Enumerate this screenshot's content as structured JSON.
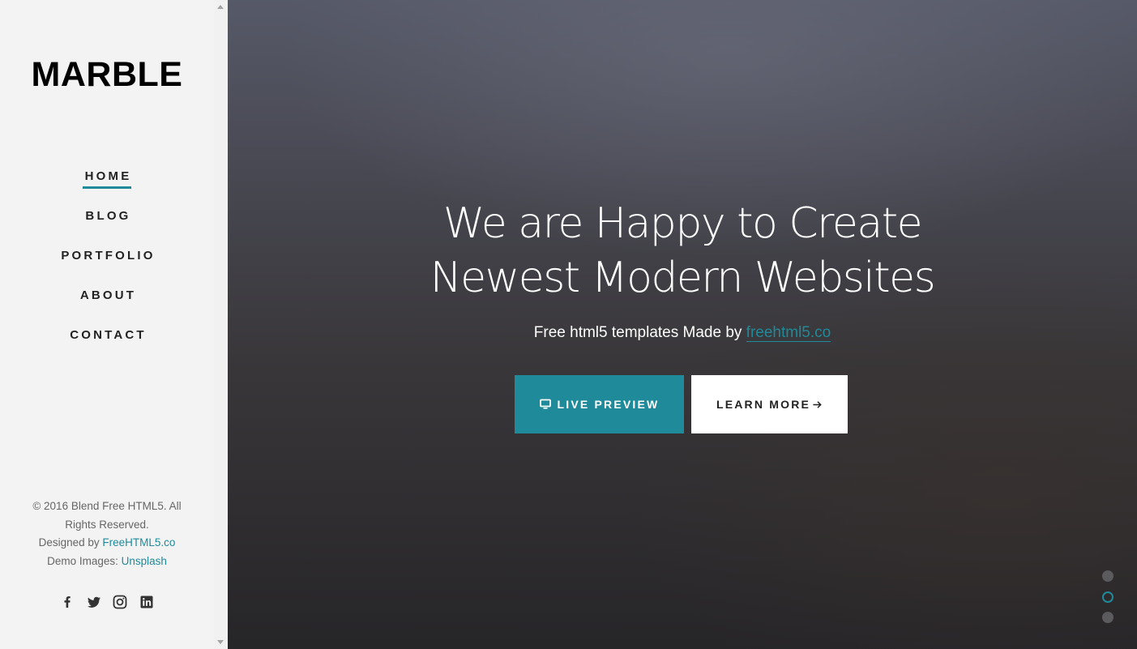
{
  "sidebar": {
    "logo": "MARBLE",
    "nav": [
      {
        "label": "HOME",
        "active": true
      },
      {
        "label": "BLOG",
        "active": false
      },
      {
        "label": "PORTFOLIO",
        "active": false
      },
      {
        "label": "ABOUT",
        "active": false
      },
      {
        "label": "CONTACT",
        "active": false
      }
    ],
    "footer": {
      "copyright_line1": "© 2016 Blend Free HTML5. All",
      "copyright_line2": "Rights Reserved.",
      "designed_prefix": "Designed by ",
      "designed_link": "FreeHTML5.co",
      "images_prefix": "Demo Images: ",
      "images_link": "Unsplash"
    },
    "social": [
      "facebook-icon",
      "twitter-icon",
      "instagram-icon",
      "linkedin-icon"
    ]
  },
  "hero": {
    "headline_line1": "We are Happy to Create",
    "headline_line2": "Newest Modern Websites",
    "subline_prefix": "Free html5 templates Made by ",
    "subline_link": "freehtml5.co",
    "live_preview_label": "LIVE PREVIEW",
    "learn_more_label": "LEARN MORE",
    "slide_dots": 3,
    "active_slide": 2
  },
  "colors": {
    "accent": "#1f8a9a",
    "sidebar_bg": "#f4f3f4"
  }
}
